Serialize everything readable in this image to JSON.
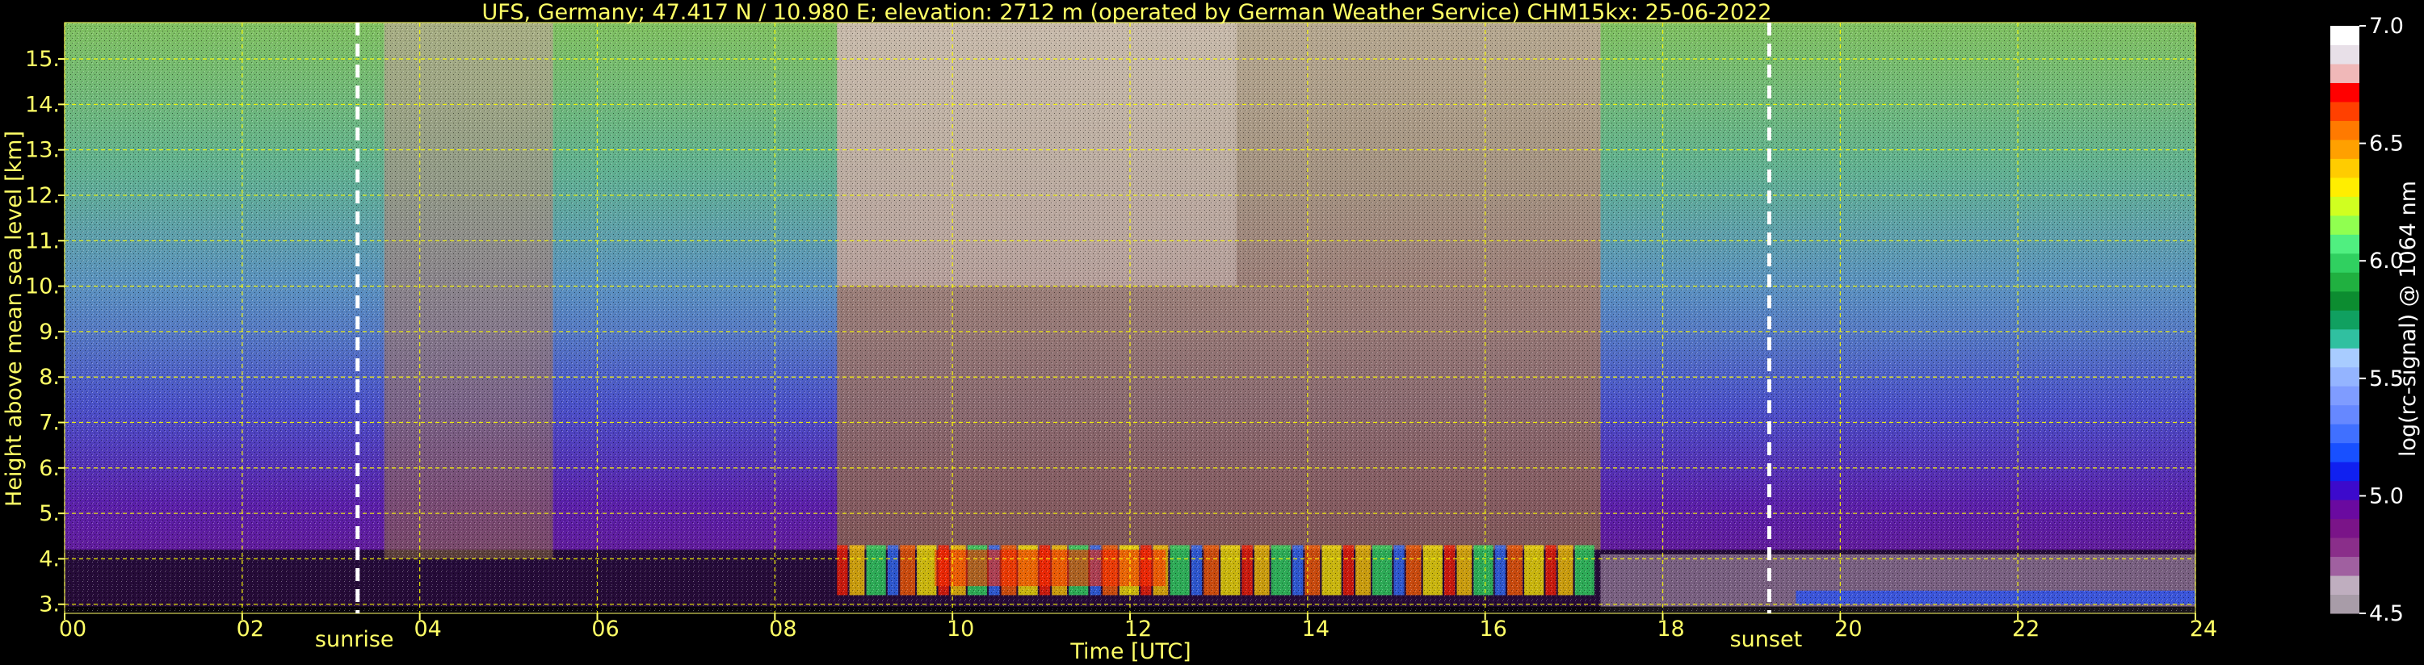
{
  "chart_data": {
    "type": "heatmap",
    "title": "UFS, Germany; 47.417 N / 10.980 E; elevation: 2712 m  (operated by German Weather Service)    CHM15kx: 25-06-2022",
    "xlabel": "Time [UTC]",
    "ylabel": "Height above mean sea level [km]",
    "xlim": [
      0,
      24
    ],
    "ylim": [
      2.8,
      15.8
    ],
    "x_ticks": [
      "00",
      "02",
      "04",
      "06",
      "08",
      "10",
      "12",
      "14",
      "16",
      "18",
      "20",
      "22",
      "24"
    ],
    "y_ticks": [
      "3.",
      "4.",
      "5.",
      "6.",
      "7.",
      "8.",
      "9.",
      "10.",
      "11.",
      "12.",
      "13.",
      "14.",
      "15."
    ],
    "grid": true,
    "events": [
      {
        "label": "sunrise",
        "x": 3.3
      },
      {
        "label": "sunset",
        "x": 19.2
      }
    ],
    "colorbar": {
      "label": "log(rc-signal) @ 1064 nm",
      "range": [
        4.5,
        7.0
      ],
      "ticks": [
        "4.5",
        "5.0",
        "5.5",
        "6.0",
        "6.5",
        "7.0"
      ],
      "colors": [
        "#a89ca8",
        "#bfaebf",
        "#a060a0",
        "#8a2e8a",
        "#7a1488",
        "#6a0aa0",
        "#3c0acc",
        "#1020f0",
        "#1850ff",
        "#4070ff",
        "#6688ff",
        "#7f9cff",
        "#94b4ff",
        "#a8ccff",
        "#30c0a0",
        "#10a060",
        "#0c8c30",
        "#20b040",
        "#30d060",
        "#50ef80",
        "#90ff50",
        "#d0ff20",
        "#ffee00",
        "#ffcc00",
        "#ffa000",
        "#ff7a00",
        "#ff4000",
        "#ff0000",
        "#f0b8b8",
        "#e8e0e8",
        "#ffffff"
      ]
    }
  },
  "colors": {
    "text_yellow": "#ffff66",
    "grid": "#ffff00",
    "background": "#000000"
  }
}
